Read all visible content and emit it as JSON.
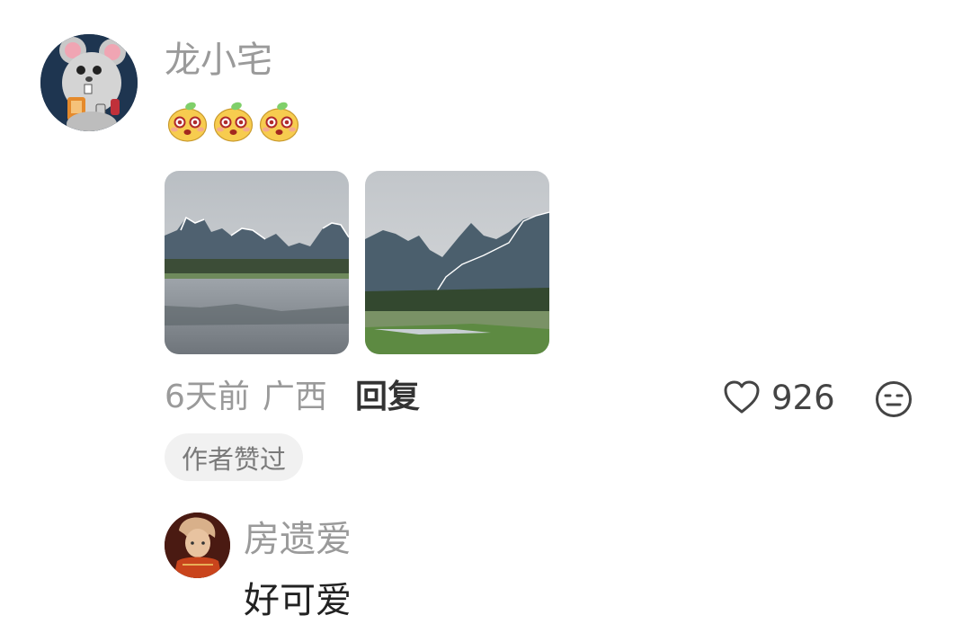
{
  "comment": {
    "username": "龙小宅",
    "emoji_icons": [
      "cute-face-emoji",
      "cute-face-emoji",
      "cute-face-emoji"
    ],
    "photos": [
      "mountain-lake-photo",
      "mountain-golf-course-photo"
    ],
    "time": "6天前",
    "location": "广西",
    "reply_label": "回复",
    "like_count": "926",
    "author_badge": "作者赞过"
  },
  "reply": {
    "username": "房遗爱",
    "text": "好可爱"
  },
  "colors": {
    "muted_text": "#9a9a9a",
    "primary_text": "#333333",
    "badge_bg": "#f1f1f1"
  }
}
